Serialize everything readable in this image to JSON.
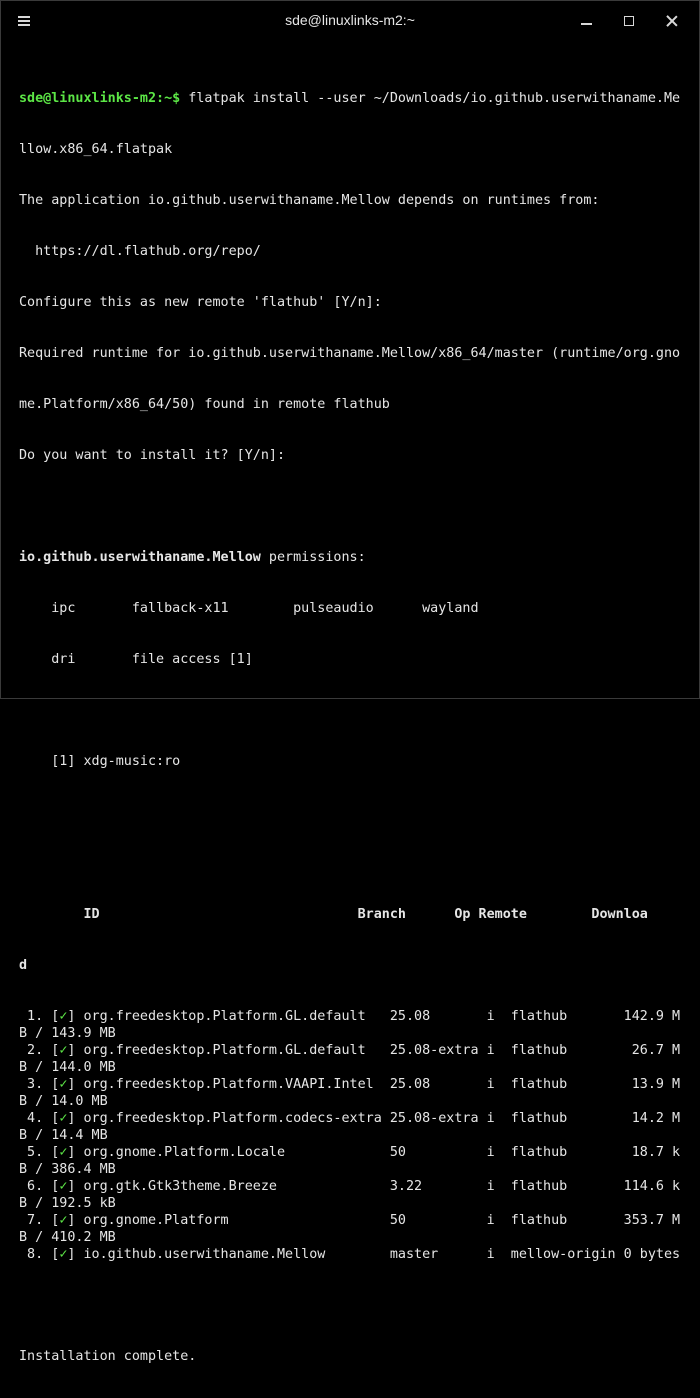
{
  "window": {
    "title": "sde@linuxlinks-m2:~"
  },
  "icons": {
    "menu": "hamburger-menu-icon",
    "minimize": "minimize-icon",
    "maximize": "maximize-icon",
    "close": "close-icon"
  },
  "colors": {
    "background": "#000000",
    "text": "#e6e6e6",
    "prompt": "#5ce646",
    "cursor": "#d21fd2"
  },
  "terminal": {
    "prompt": "sde@linuxlinks-m2:~$",
    "command_l1": " flatpak install --user ~/Downloads/io.github.userwithaname.Me",
    "command_l2": "llow.x86_64.flatpak",
    "out_depends": "The application io.github.userwithaname.Mellow depends on runtimes from:",
    "out_repo_url": "  https://dl.flathub.org/repo/",
    "out_configure": "Configure this as new remote 'flathub' [Y/n]:",
    "out_required_l1": "Required runtime for io.github.userwithaname.Mellow/x86_64/master (runtime/org.gno",
    "out_required_l2": "me.Platform/x86_64/50) found in remote flathub",
    "out_question": "Do you want to install it? [Y/n]:",
    "perm_app": "io.github.userwithaname.Mellow",
    "perm_label": " permissions:",
    "perm_row1": "    ipc       fallback-x11        pulseaudio      wayland",
    "perm_row2": "    dri       file access [1]",
    "perm_footnote": "    [1] xdg-music:ro",
    "table_header": "        ID                                Branch      Op Remote        Downloa",
    "table_header_wrap": "d",
    "check_mark": "✓",
    "rows": [
      {
        "pre": " 1. [",
        "post": "] org.freedesktop.Platform.GL.default   25.08       i  flathub       142.9 M",
        "wrap": "B / 143.9 MB"
      },
      {
        "pre": " 2. [",
        "post": "] org.freedesktop.Platform.GL.default   25.08-extra i  flathub        26.7 M",
        "wrap": "B / 144.0 MB"
      },
      {
        "pre": " 3. [",
        "post": "] org.freedesktop.Platform.VAAPI.Intel  25.08       i  flathub        13.9 M",
        "wrap": "B / 14.0 MB"
      },
      {
        "pre": " 4. [",
        "post": "] org.freedesktop.Platform.codecs-extra 25.08-extra i  flathub        14.2 M",
        "wrap": "B / 14.4 MB"
      },
      {
        "pre": " 5. [",
        "post": "] org.gnome.Platform.Locale             50          i  flathub        18.7 k",
        "wrap": "B / 386.4 MB"
      },
      {
        "pre": " 6. [",
        "post": "] org.gtk.Gtk3theme.Breeze              3.22        i  flathub       114.6 k",
        "wrap": "B / 192.5 kB"
      },
      {
        "pre": " 7. [",
        "post": "] org.gnome.Platform                    50          i  flathub       353.7 M",
        "wrap": "B / 410.2 MB"
      },
      {
        "pre": " 8. [",
        "post": "] io.github.userwithaname.Mellow        master      i  mellow-origin 0 bytes",
        "wrap": ""
      }
    ],
    "complete": "Installation complete."
  }
}
